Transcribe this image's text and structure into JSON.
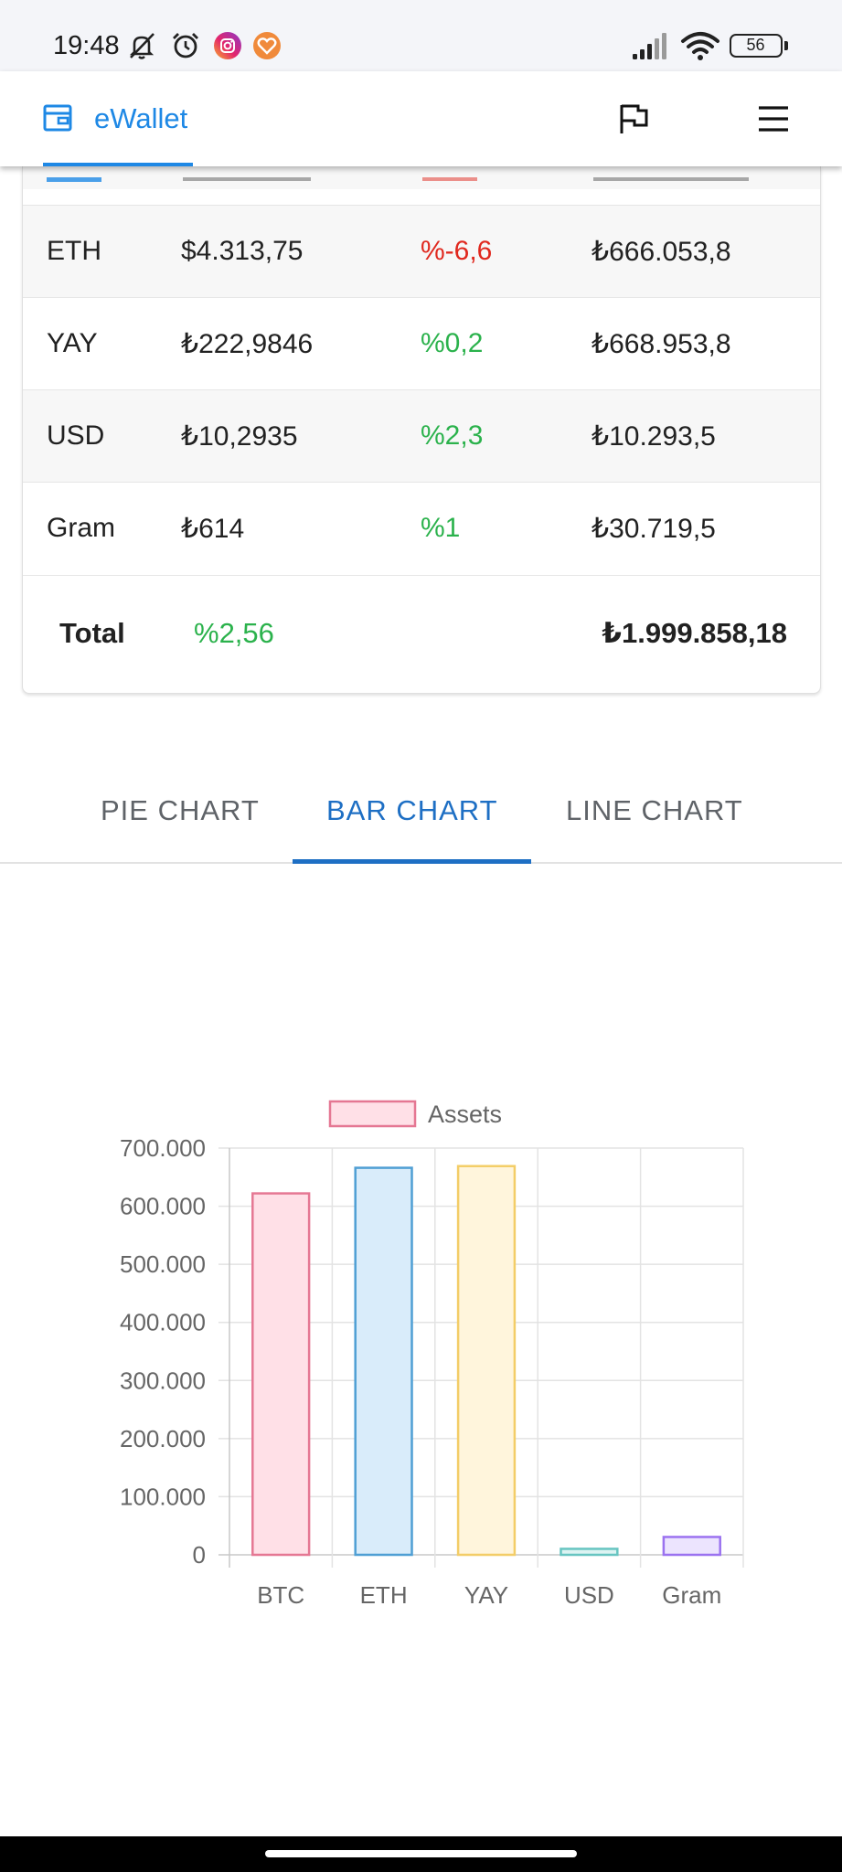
{
  "status_bar": {
    "time": "19:48",
    "battery": "56",
    "icons": [
      "mute-icon",
      "alarm-icon",
      "instagram-icon",
      "notification-app-icon",
      "signal-icon",
      "wifi-icon",
      "battery-icon"
    ]
  },
  "app_bar": {
    "brand": "eWallet",
    "brand_icon": "wallet-icon",
    "language_icon": "flag-icon",
    "menu_icon": "hamburger-menu-icon",
    "accent_color": "#1e88e5"
  },
  "table": {
    "rows": [
      {
        "asset": "ETH",
        "price": "$4.313,75",
        "change": "%-6,6",
        "change_trend": "negative",
        "value": "₺666.053,8"
      },
      {
        "asset": "YAY",
        "price": "₺222,9846",
        "change": "%0,2",
        "change_trend": "positive",
        "value": "₺668.953,8"
      },
      {
        "asset": "USD",
        "price": "₺10,2935",
        "change": "%2,3",
        "change_trend": "positive",
        "value": "₺10.293,5"
      },
      {
        "asset": "Gram",
        "price": "₺614",
        "change": "%1",
        "change_trend": "positive",
        "value": "₺30.719,5"
      }
    ],
    "total": {
      "label": "Total",
      "change": "%2,56",
      "amount": "₺1.999.858,18"
    },
    "colors": {
      "positive": "#2bb24c",
      "negative": "#e0281e"
    }
  },
  "tabs": [
    {
      "label": "PIE CHART",
      "active": false
    },
    {
      "label": "BAR CHART",
      "active": true
    },
    {
      "label": "LINE CHART",
      "active": false
    }
  ],
  "chart_data": {
    "type": "bar",
    "categories": [
      "BTC",
      "ETH",
      "YAY",
      "USD",
      "Gram"
    ],
    "series": [
      {
        "name": "Assets",
        "values": [
          622000,
          666053.8,
          668953.8,
          10293.5,
          30719.5
        ]
      }
    ],
    "bar_colors": {
      "fill": [
        "#ffe0e7",
        "#d9ecfa",
        "#fff5dc",
        "#dcf3f2",
        "#ece4fe"
      ],
      "stroke": [
        "#e57793",
        "#4f9fd4",
        "#f3cd67",
        "#67c5c1",
        "#9b72f0"
      ]
    },
    "ylim": [
      0,
      700000
    ],
    "yticks": [
      "0",
      "100.000",
      "200.000",
      "300.000",
      "400.000",
      "500.000",
      "600.000",
      "700.000"
    ],
    "legend": "top",
    "grid": true
  }
}
